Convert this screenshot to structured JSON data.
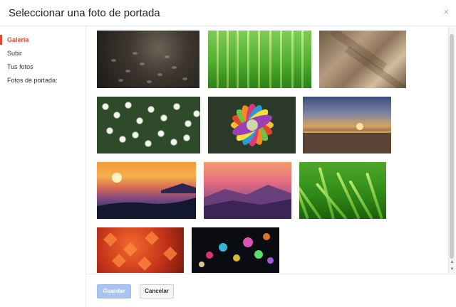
{
  "dialog": {
    "title": "Seleccionar una foto de portada",
    "close_glyph": "×"
  },
  "sidebar": {
    "items": [
      {
        "label": "Galería",
        "active": true
      },
      {
        "label": "Subir",
        "active": false
      },
      {
        "label": "Tus fotos",
        "active": false
      },
      {
        "label": "Fotos de portada:",
        "active": false
      }
    ]
  },
  "gallery": {
    "photos": [
      {
        "name": "rain-drops"
      },
      {
        "name": "green-stems"
      },
      {
        "name": "folded-paper"
      },
      {
        "name": "white-flowers"
      },
      {
        "name": "color-petals"
      },
      {
        "name": "lake-sunset"
      },
      {
        "name": "orange-sunset"
      },
      {
        "name": "purple-mountains"
      },
      {
        "name": "green-grass"
      },
      {
        "name": "maple-leaves"
      },
      {
        "name": "bokeh-lights"
      }
    ]
  },
  "scrollbar": {
    "up_glyph": "▲",
    "down_glyph": "▼"
  },
  "footer": {
    "save_label": "Guardar",
    "cancel_label": "Cancelar"
  },
  "colors": {
    "accent_red": "#dd4b39",
    "save_blue": "#a9c4ef"
  }
}
